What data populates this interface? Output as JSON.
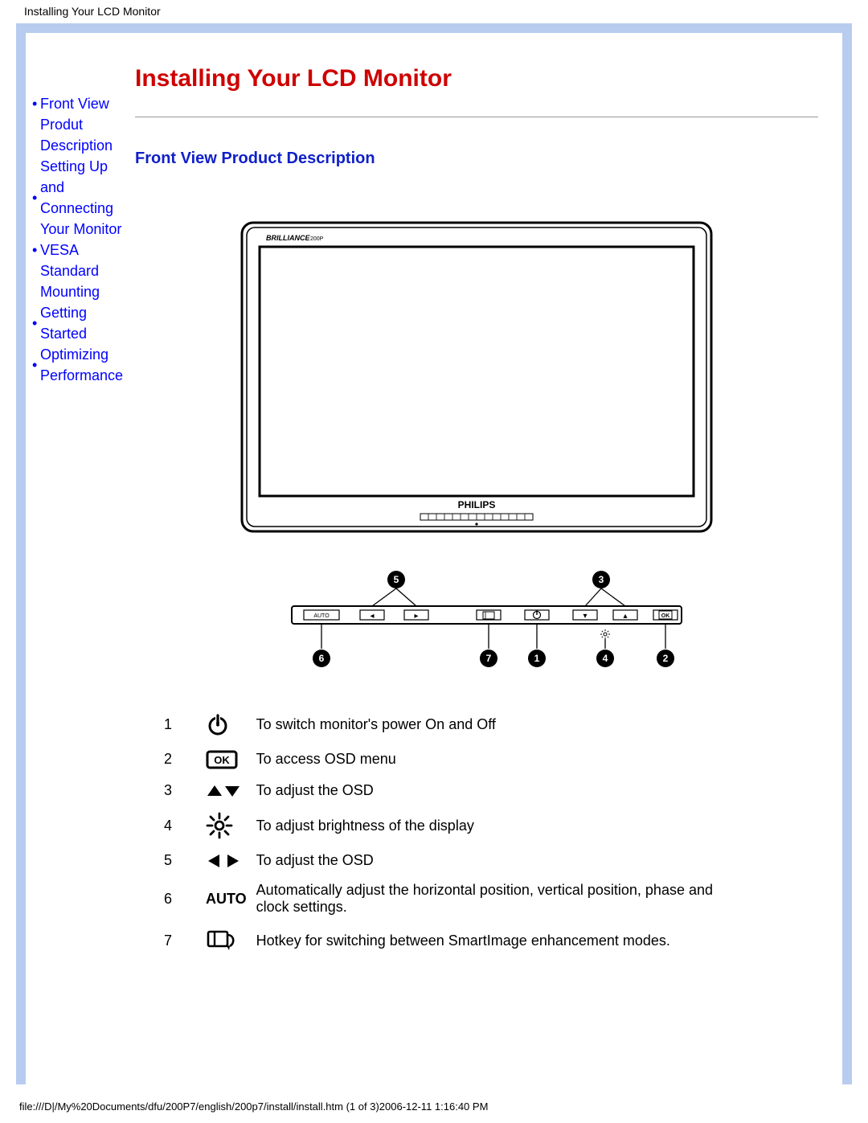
{
  "doc_title": "Installing Your LCD Monitor",
  "sidebar": {
    "items": [
      {
        "label": "Front View Produt Description"
      },
      {
        "label": "Setting Up and Connecting Your Monitor"
      },
      {
        "label": "VESA Standard Mounting"
      },
      {
        "label": "Getting Started"
      },
      {
        "label": "Optimizing Performance"
      }
    ]
  },
  "main": {
    "h1": "Installing Your LCD Monitor",
    "h2": "Front View Product Description",
    "monitor_brand_small": "BRILLIANCE 200P",
    "monitor_brand_main": "PHILIPS",
    "control_labels": {
      "auto": "AUTO",
      "left": "◂",
      "right": "▸",
      "pic": "▦",
      "power": "⏻",
      "down": "▾",
      "up": "▴",
      "ok": "OK",
      "bright": "☼"
    },
    "callouts": {
      "c1": "1",
      "c2": "2",
      "c3": "3",
      "c4": "4",
      "c5": "5",
      "c6": "6",
      "c7": "7"
    },
    "table": [
      {
        "num": "1",
        "icon": "power",
        "desc": "To switch monitor's power On and Off"
      },
      {
        "num": "2",
        "icon": "ok",
        "desc": "To access OSD menu"
      },
      {
        "num": "3",
        "icon": "updown",
        "desc": "To adjust the OSD"
      },
      {
        "num": "4",
        "icon": "brightness",
        "desc": "To adjust brightness of the display"
      },
      {
        "num": "5",
        "icon": "leftright",
        "desc": "To adjust the OSD"
      },
      {
        "num": "6",
        "icon": "auto",
        "desc": "Automatically adjust the horizontal position, vertical position, phase and clock settings."
      },
      {
        "num": "7",
        "icon": "smart",
        "desc": "Hotkey for switching between SmartImage enhancement modes."
      }
    ]
  },
  "footer": "file:///D|/My%20Documents/dfu/200P7/english/200p7/install/install.htm (1 of 3)2006-12-11 1:16:40 PM"
}
